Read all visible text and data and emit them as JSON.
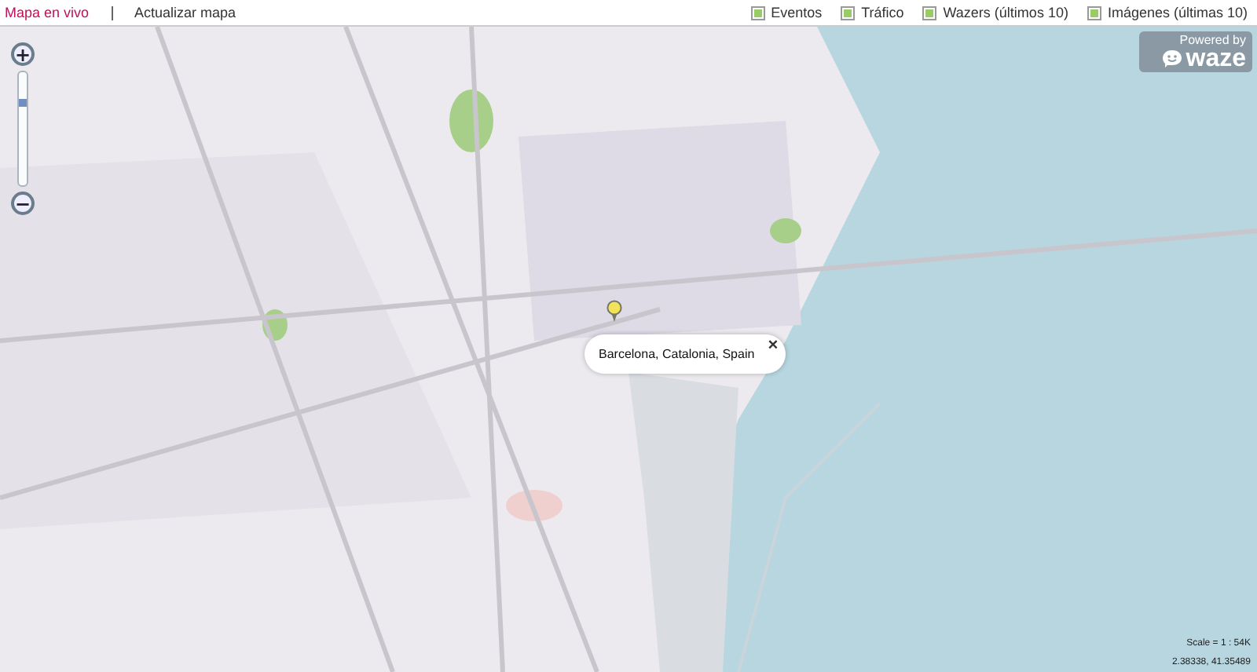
{
  "nav": [
    {
      "label": "Mapa en vivo",
      "selected": true
    },
    {
      "label": "Actualizar mapa",
      "selected": false
    }
  ],
  "layers": [
    {
      "label": "Eventos",
      "checked": true
    },
    {
      "label": "Tráfico",
      "checked": true
    },
    {
      "label": "Wazers (últimos 10)",
      "checked": true
    },
    {
      "label": "Imágenes (últimas 10)",
      "checked": true
    }
  ],
  "branding": {
    "caption": "Powered by",
    "logo": "waze"
  },
  "zoom": {
    "in": "+",
    "out": "−",
    "level": 0.75
  },
  "popup": {
    "text": "Barcelona, Catalonia, Spain",
    "close": "×"
  },
  "scale": "Scale = 1 : 54K",
  "coordinates": "2.38338, 41.35489"
}
